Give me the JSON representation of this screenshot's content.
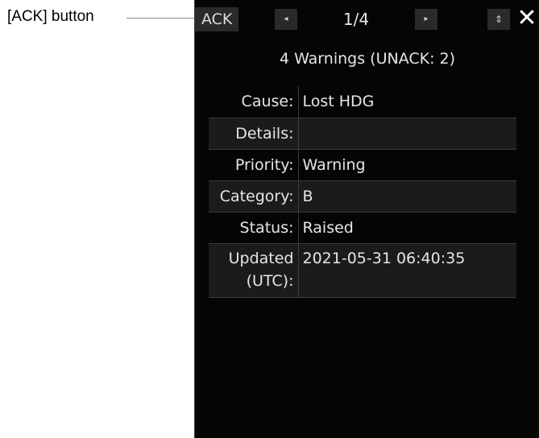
{
  "annotation": {
    "label": "[ACK] button"
  },
  "toolbar": {
    "ack_label": "ACK",
    "prev_glyph": "◂",
    "next_glyph": "▸",
    "page_indicator": "1/4",
    "updown_glyph": "⇕",
    "close_glyph": "✕"
  },
  "summary": "4 Warnings (UNACK: 2)",
  "details": [
    {
      "key": "Cause:",
      "value": "Lost HDG"
    },
    {
      "key": "Details:",
      "value": ""
    },
    {
      "key": "Priority:",
      "value": "Warning"
    },
    {
      "key": "Category:",
      "value": "B"
    },
    {
      "key": "Status:",
      "value": "Raised"
    },
    {
      "key_line1": "Updated",
      "key_line2": "(UTC):",
      "value": "2021-05-31 06:40:35"
    }
  ]
}
